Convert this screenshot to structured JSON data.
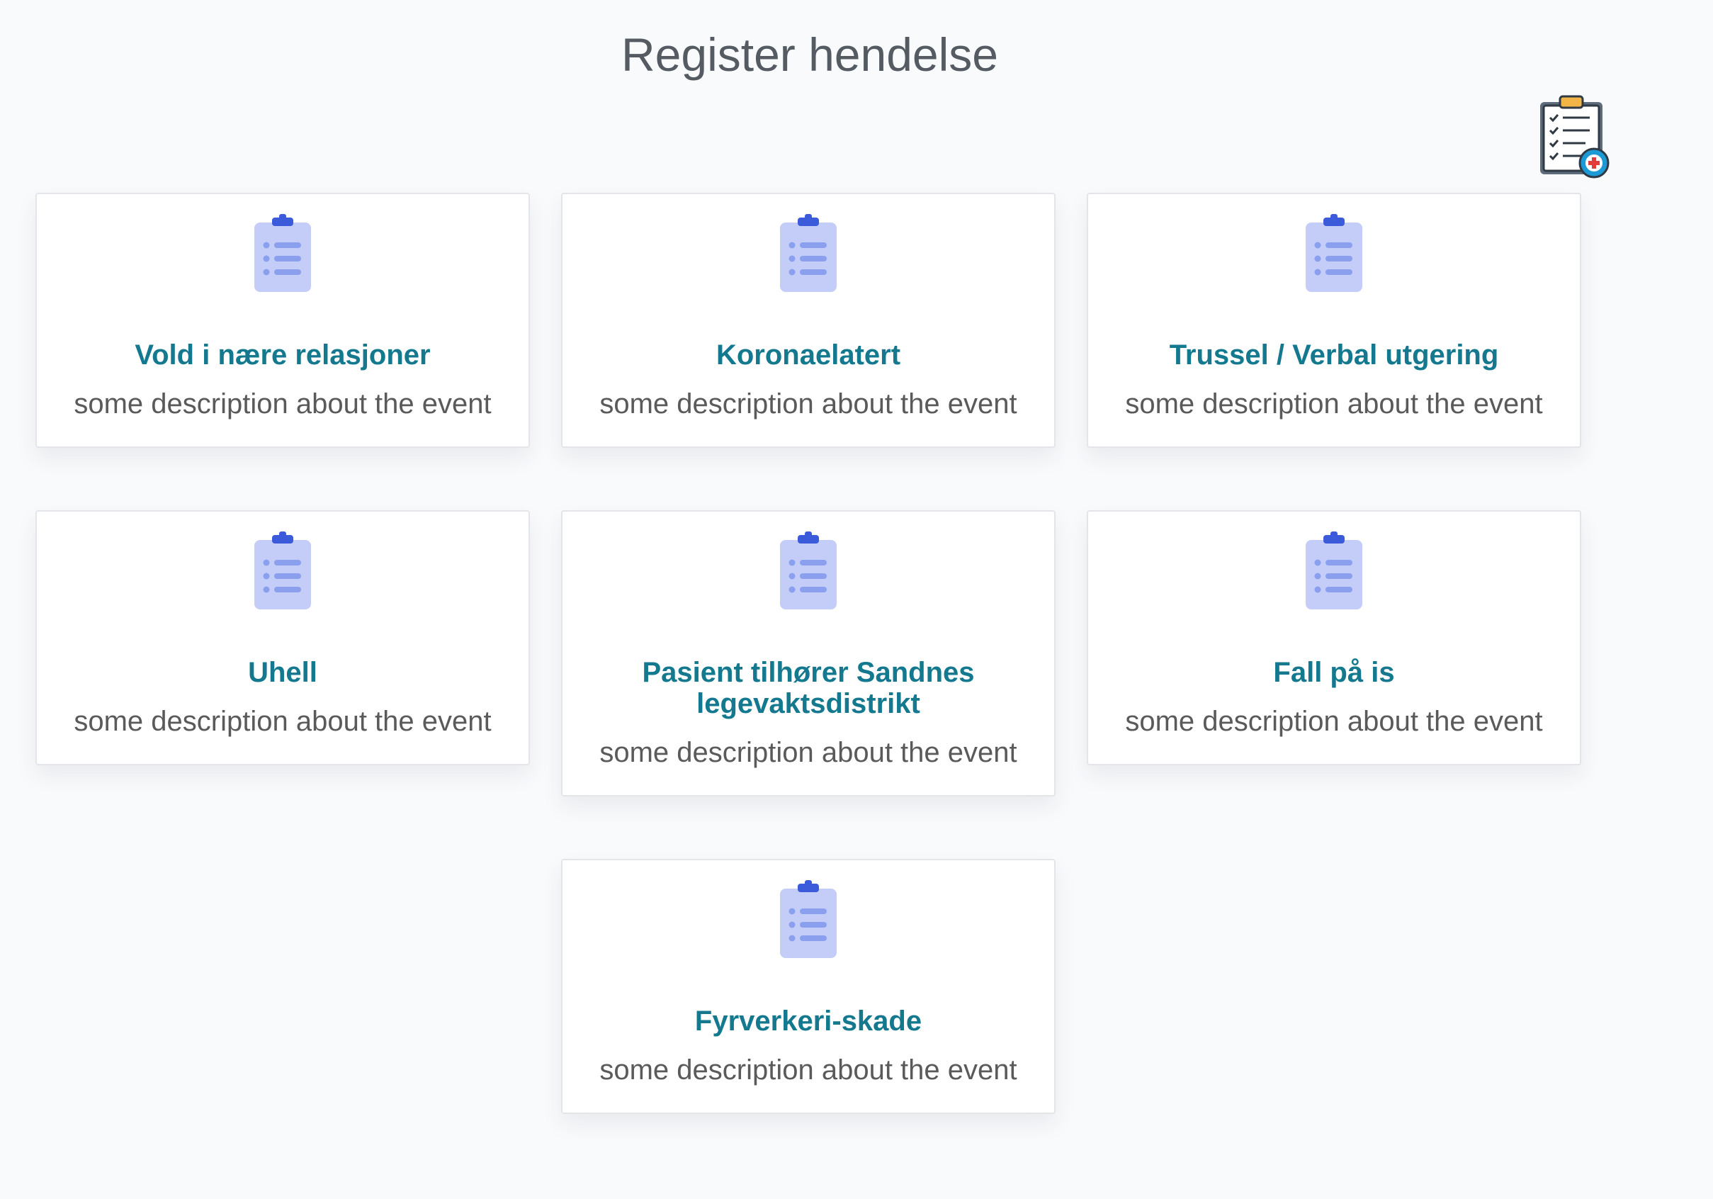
{
  "page": {
    "title": "Register hendelse"
  },
  "header_icon": "clipboard-add-icon",
  "colors": {
    "background": "#f9fafc",
    "card_title": "#14798f",
    "card_description": "#5a5a5a",
    "icon_clipboard": "#c3cdf7",
    "icon_accent": "#3b5bdb"
  },
  "cards": [
    {
      "title": "Vold i nære relasjoner",
      "description": "some description about the event",
      "icon": "clipboard-list-icon"
    },
    {
      "title": "Koronaelatert",
      "description": "some description about the event",
      "icon": "clipboard-list-icon"
    },
    {
      "title": "Trussel / Verbal utgering",
      "description": "some description about the event",
      "icon": "clipboard-list-icon"
    },
    {
      "title": "Uhell",
      "description": "some description about the event",
      "icon": "clipboard-list-icon"
    },
    {
      "title": "Pasient tilhører Sandnes legevaktsdistrikt",
      "description": "some description about the event",
      "icon": "clipboard-list-icon"
    },
    {
      "title": "Fall på is",
      "description": "some description about the event",
      "icon": "clipboard-list-icon"
    },
    {
      "title": "Fyrverkeri-skade",
      "description": "some description about the event",
      "icon": "clipboard-list-icon"
    }
  ]
}
